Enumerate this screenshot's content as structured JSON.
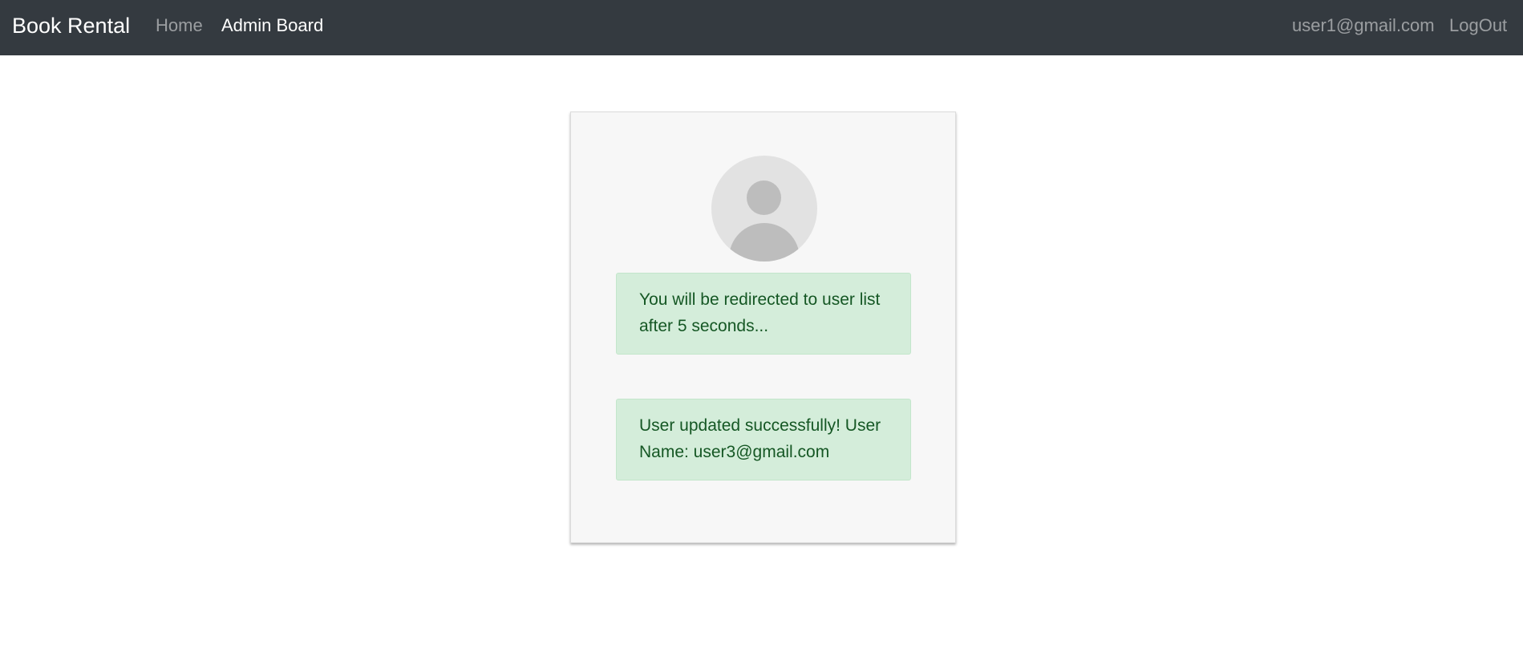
{
  "navbar": {
    "brand": "Book Rental",
    "links": {
      "home": "Home",
      "admin_board": "Admin Board"
    },
    "user_email": "user1@gmail.com",
    "logout": "LogOut"
  },
  "card": {
    "avatar_icon": "user-avatar-icon",
    "redirect_message": "You will be redirected to user list after 5 seconds...",
    "success_message": "User updated successfully! User Name: user3@gmail.com"
  },
  "colors": {
    "navbar_bg": "#343a40",
    "alert_bg": "#d4edda",
    "alert_text": "#155724"
  }
}
